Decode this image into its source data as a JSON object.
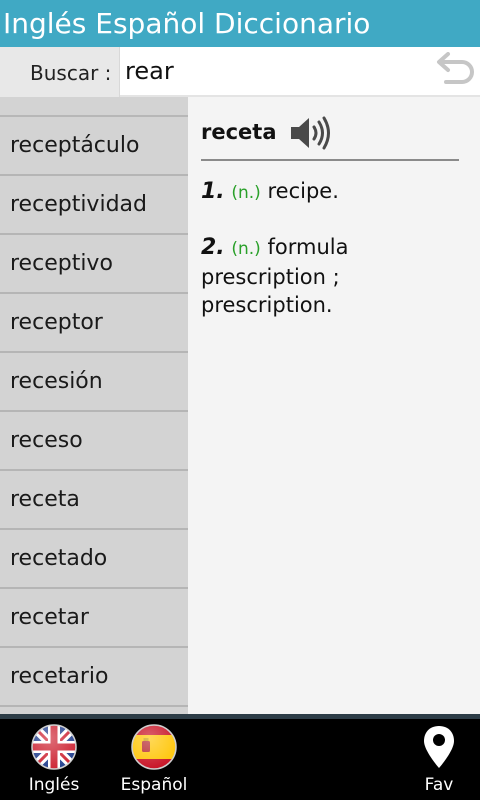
{
  "app": {
    "title": "Inglés Español Diccionario"
  },
  "search": {
    "label": "Buscar :",
    "value": "rear"
  },
  "word_list": {
    "items": [
      "receptáculo",
      "receptividad",
      "receptivo",
      "receptor",
      "recesión",
      "receso",
      "receta",
      "recetado",
      "recetar",
      "recetario"
    ]
  },
  "definition": {
    "word": "receta",
    "senses": [
      {
        "number": "1.",
        "pos": "(n.)",
        "text": "recipe."
      },
      {
        "number": "2.",
        "pos": "(n.)",
        "text": "formula prescription ; prescription."
      }
    ]
  },
  "tabs": [
    {
      "label": "Inglés",
      "icon": "uk-flag-icon"
    },
    {
      "label": "Español",
      "icon": "spain-flag-icon"
    },
    {
      "label": "Fav",
      "icon": "location-pin-icon"
    }
  ],
  "colors": {
    "title_bar": "#40a9c4",
    "list_bg": "#d3d3d3",
    "pos_green": "#2aa02a",
    "bottom_bar": "#000000"
  }
}
